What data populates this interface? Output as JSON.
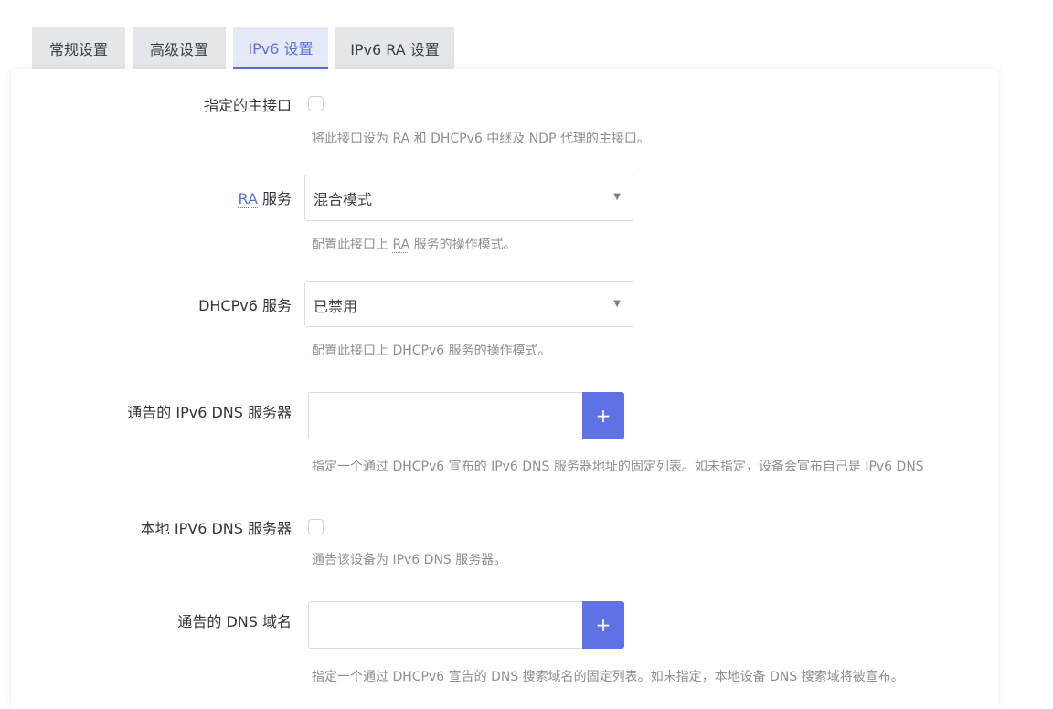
{
  "tabs": [
    {
      "label": "常规设置"
    },
    {
      "label": "高级设置"
    },
    {
      "label": "IPv6 设置"
    },
    {
      "label": "IPv6 RA 设置"
    }
  ],
  "fields": {
    "master": {
      "label": "指定的主接口",
      "checked": false,
      "help": "将此接口设为 RA 和 DHCPv6 中继及 NDP 代理的主接口。"
    },
    "ra": {
      "label_abbr": "RA",
      "label_rest": " 服务",
      "value": "混合模式",
      "help_pre": "配置此接口上 ",
      "help_abbr": "RA",
      "help_post": " 服务的操作模式。"
    },
    "dhcpv6": {
      "label": "DHCPv6 服务",
      "value": "已禁用",
      "help": "配置此接口上 DHCPv6 服务的操作模式。"
    },
    "ipv6_dns": {
      "label": "通告的 IPv6 DNS 服务器",
      "value": "",
      "button": "+",
      "help": "指定一个通过 DHCPv6 宣布的 IPv6 DNS 服务器地址的固定列表。如未指定，设备会宣布自己是 IPv6 DNS"
    },
    "local_dns": {
      "label": "本地 IPV6 DNS 服务器",
      "checked": false,
      "help": "通告该设备为 IPv6 DNS 服务器。"
    },
    "dns_domain": {
      "label": "通告的 DNS 域名",
      "value": "",
      "button": "+",
      "help": "指定一个通过 DHCPv6 宣告的 DNS 搜索域名的固定列表。如未指定，本地设备 DNS 搜索域将被宣布。"
    }
  },
  "icons": {
    "select_caret": "caret-down-icon",
    "add": "plus-icon"
  },
  "colors": {
    "accent": "#5e72e4",
    "tab_active_text": "#5b6fd8",
    "tab_bg": "#e4e7ea",
    "help_text": "#8a9097"
  }
}
